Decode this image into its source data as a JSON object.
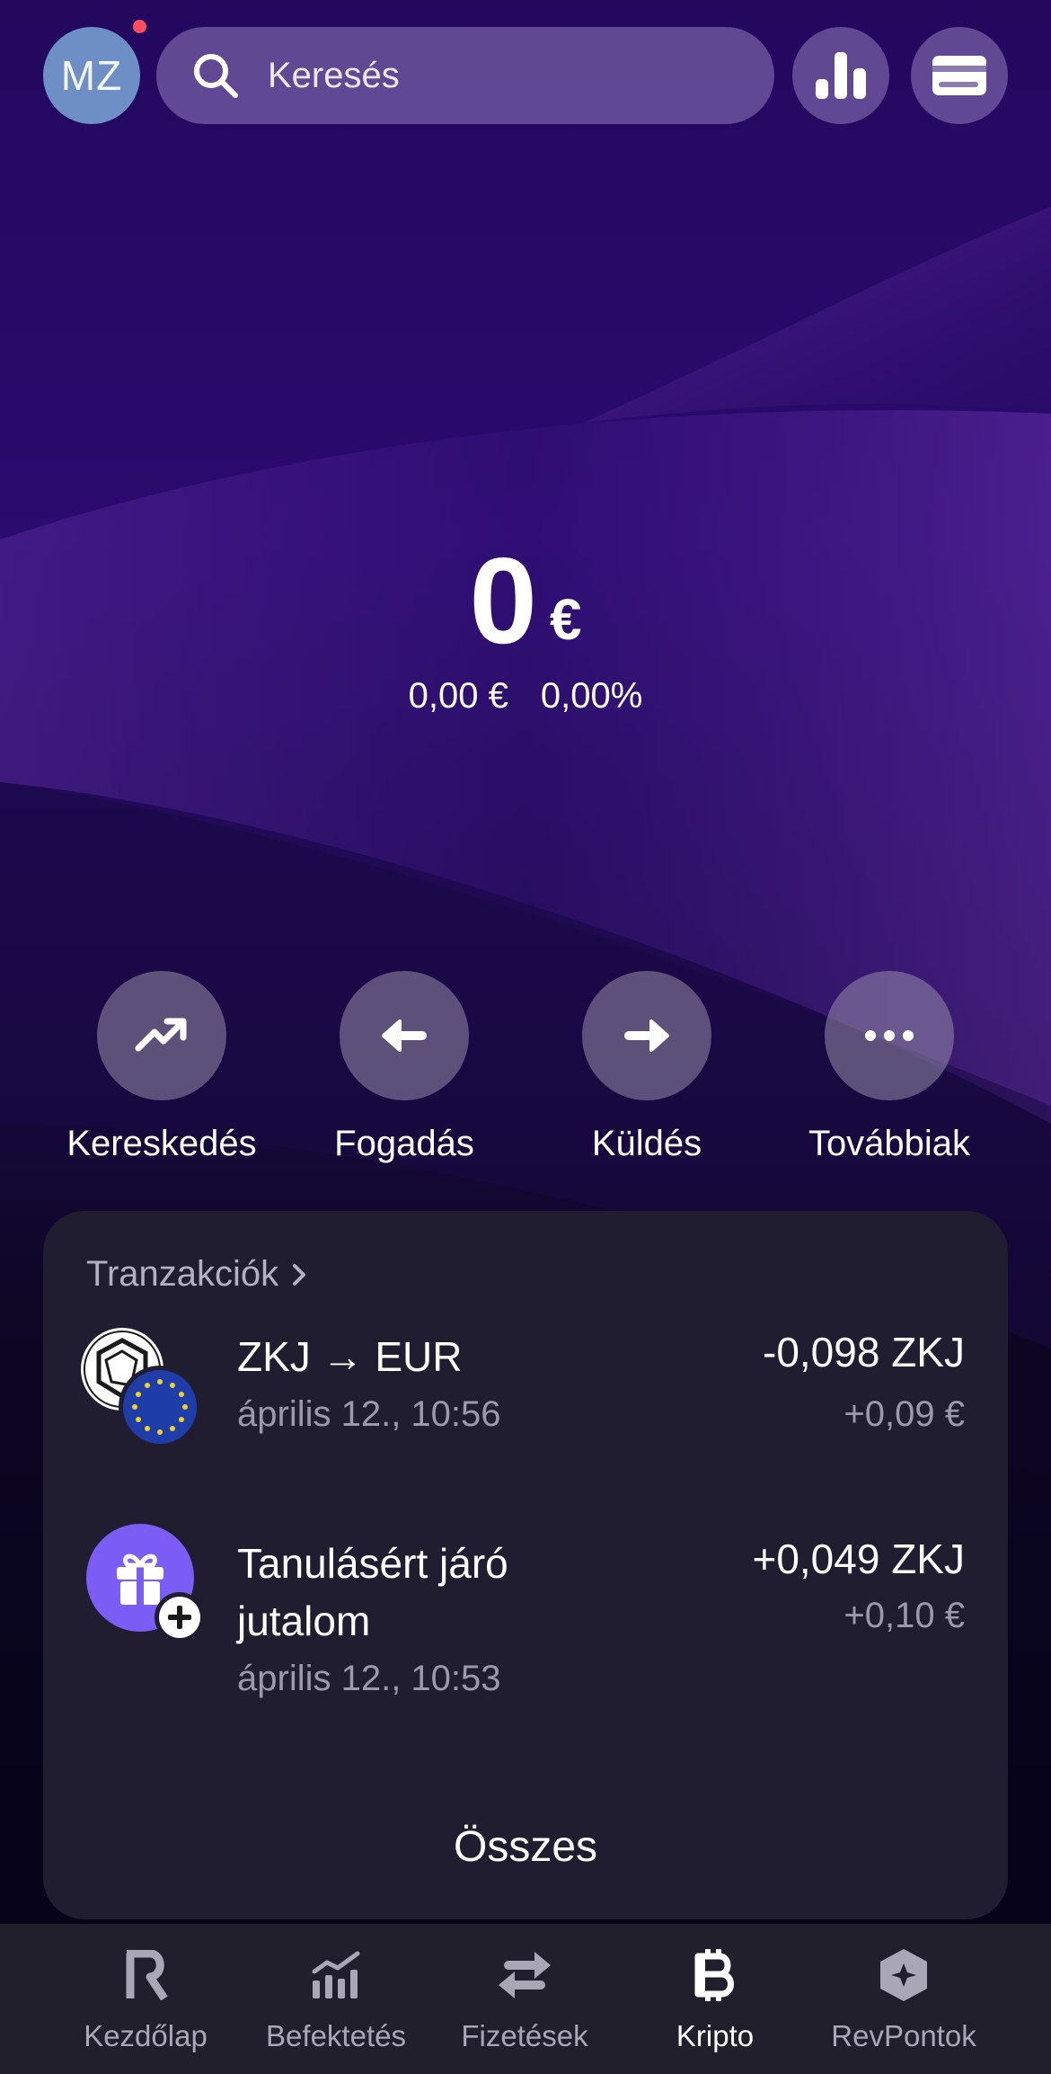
{
  "header": {
    "avatar_initials": "MZ",
    "search_placeholder": "Keresés",
    "notification_dot_color": "#ff4d5e"
  },
  "balance": {
    "amount": "0",
    "currency": "€",
    "change_value": "0,00 €",
    "change_percent": "0,00%"
  },
  "actions": [
    {
      "label": "Kereskedés",
      "icon": "trend-up-icon"
    },
    {
      "label": "Fogadás",
      "icon": "arrow-left-icon"
    },
    {
      "label": "Küldés",
      "icon": "arrow-right-icon"
    },
    {
      "label": "Továbbiak",
      "icon": "more-icon"
    }
  ],
  "transactions": {
    "title": "Tranzakciók",
    "items": [
      {
        "name": "ZKJ → EUR",
        "date": "április 12., 10:56",
        "amount": "-0,098 ZKJ",
        "fiat": "+0,09 €",
        "icon": "zkj-eur-exchange-icon"
      },
      {
        "name_line1": "Tanulásért járó",
        "name_line2": "jutalom",
        "date": "április 12., 10:53",
        "amount": "+0,049 ZKJ",
        "fiat": "+0,10 €",
        "icon": "gift-icon"
      }
    ],
    "all_label": "Összes"
  },
  "nav": [
    {
      "label": "Kezdőlap",
      "icon": "revolut-logo-icon",
      "active": false
    },
    {
      "label": "Befektetés",
      "icon": "invest-chart-icon",
      "active": false
    },
    {
      "label": "Fizetések",
      "icon": "transfer-arrows-icon",
      "active": false
    },
    {
      "label": "Kripto",
      "icon": "bitcoin-icon",
      "active": true
    },
    {
      "label": "RevPontok",
      "icon": "revpoints-icon",
      "active": false
    }
  ],
  "colors": {
    "accent_purple": "#7b5cf5",
    "card_bg": "#201d31"
  }
}
